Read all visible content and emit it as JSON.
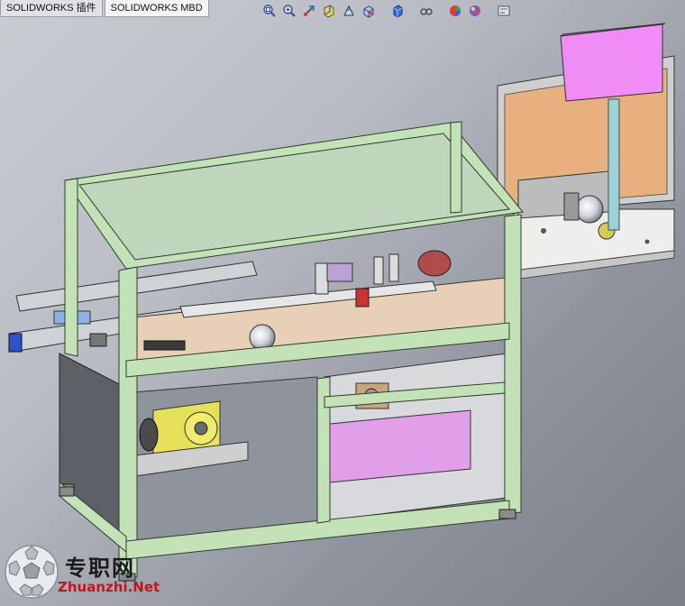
{
  "tabs": [
    {
      "label": "SOLIDWORKS 插件"
    },
    {
      "label": "SOLIDWORKS MBD"
    }
  ],
  "toolbar": {
    "icons": [
      "zoom-to-fit-icon",
      "zoom-area-icon",
      "previous-view-icon",
      "section-view-icon",
      "dynamic-annotation-icon",
      "view-orientation-icon",
      "display-style-icon",
      "hide-show-items-icon",
      "edit-appearance-icon",
      "apply-scene-icon",
      "view-settings-icon"
    ]
  },
  "watermark": {
    "name_cn": "专职网",
    "url": "Zhuanzhi.Net"
  },
  "colors": {
    "frame": "#c4e2b8",
    "table": "#f0efed",
    "cabinet_pink": "#e09fe8",
    "box_pink": "#f08cf5",
    "back_panel": "#e7b07f",
    "post_cyan": "#9fd0d8",
    "gear_yellow": "#e5e25a",
    "belt_beige": "#e8cfb8",
    "rail_blue": "#2f52c8"
  }
}
